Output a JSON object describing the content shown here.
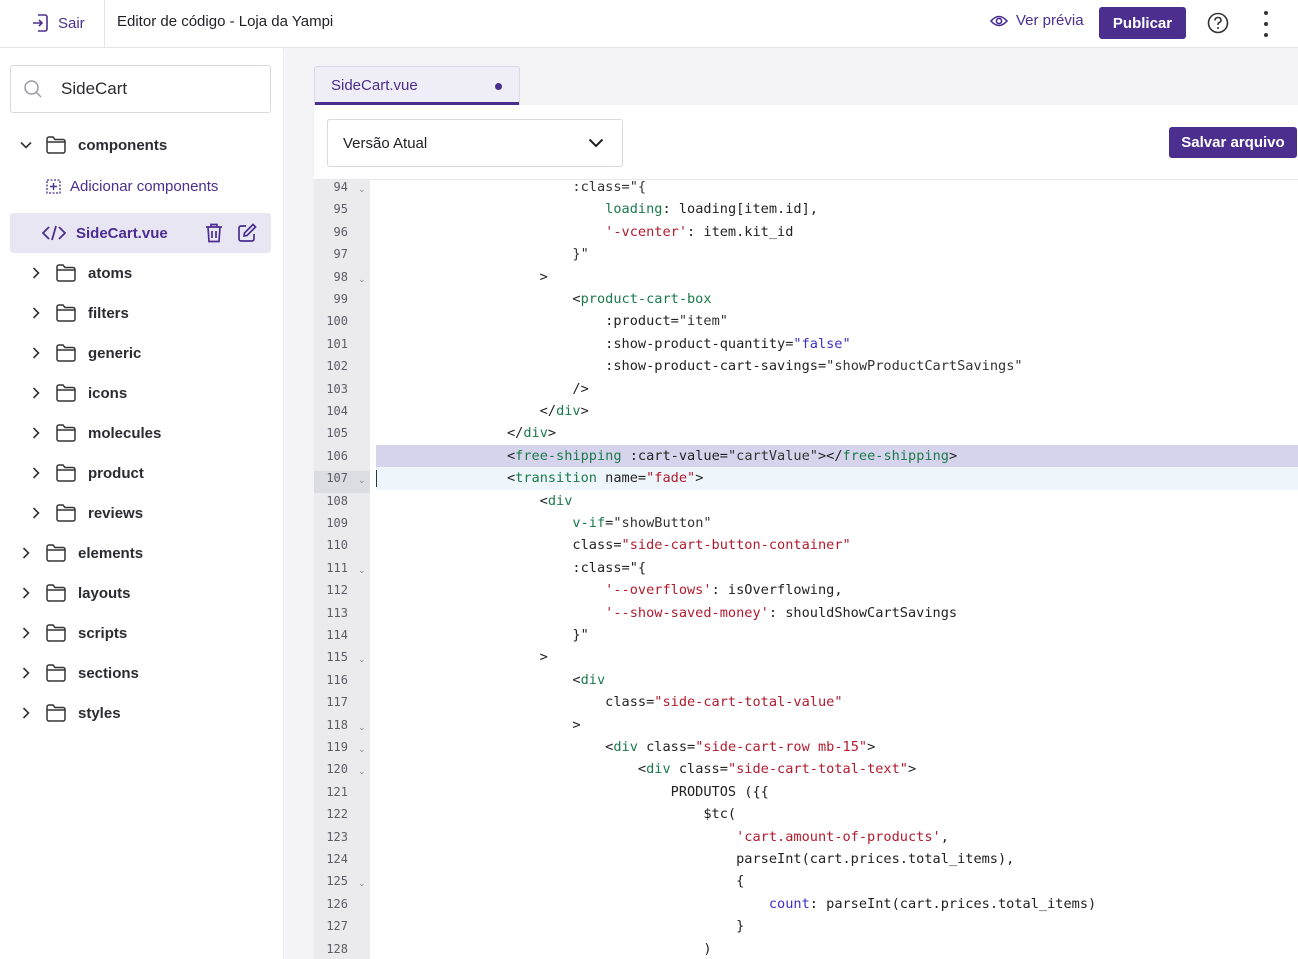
{
  "header": {
    "exit_label": "Sair",
    "title": "Editor de código - Loja da Yampi",
    "preview_label": "Ver prévia",
    "publish_label": "Publicar"
  },
  "sidebar": {
    "search_value": "SideCart",
    "root_folder": "components",
    "add_label": "Adicionar components",
    "active_file": "SideCart.vue",
    "subfolders": [
      "atoms",
      "filters",
      "generic",
      "icons",
      "molecules",
      "product",
      "reviews"
    ],
    "top_folders": [
      "elements",
      "layouts",
      "scripts",
      "sections",
      "styles"
    ]
  },
  "editor": {
    "tab_name": "SideCart.vue",
    "version_label": "Versão Atual",
    "save_label": "Salvar arquivo",
    "line_numbers": [
      "94",
      "95",
      "96",
      "97",
      "98",
      "99",
      "100",
      "101",
      "102",
      "103",
      "104",
      "105",
      "106",
      "107",
      "108",
      "109",
      "110",
      "111",
      "112",
      "113",
      "114",
      "115",
      "116",
      "117",
      "118",
      "119",
      "120",
      "121",
      "122",
      "123",
      "124",
      "125",
      "126",
      "127",
      "128"
    ],
    "highlighted_line": "106",
    "cursor_line": "107"
  }
}
